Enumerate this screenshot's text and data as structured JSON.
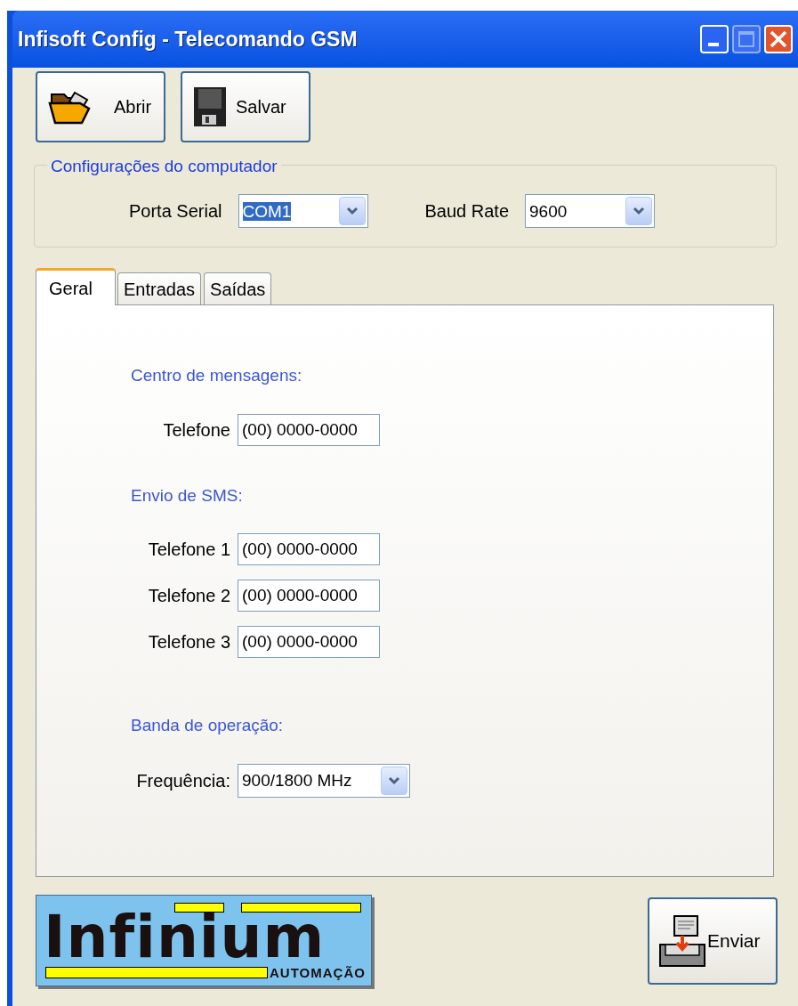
{
  "window": {
    "title": "Infisoft Config - Telecomando GSM"
  },
  "toolbar": [
    {
      "kind": "open",
      "label": "Abrir"
    },
    {
      "kind": "save",
      "label": "Salvar"
    }
  ],
  "computer_settings": {
    "title": "Configurações do computador",
    "fields": [
      {
        "label": "Porta Serial",
        "value": "COM1",
        "highlighted": true
      },
      {
        "label": "Baud Rate",
        "value": "9600",
        "highlighted": false
      }
    ]
  },
  "tabs": [
    {
      "label": "Geral",
      "selected": true
    },
    {
      "label": "Entradas",
      "selected": false
    },
    {
      "label": "Saídas",
      "selected": false
    }
  ],
  "sections": [
    {
      "heading": "Centro de mensagens:",
      "fields": [
        {
          "kind": "text",
          "label": "Telefone",
          "value": "(00) 0000-0000"
        }
      ]
    },
    {
      "heading": "Envio de SMS:",
      "fields": [
        {
          "kind": "text",
          "label": "Telefone 1",
          "value": "(00) 0000-0000"
        },
        {
          "kind": "text",
          "label": "Telefone 2",
          "value": "(00) 0000-0000"
        },
        {
          "kind": "text",
          "label": "Telefone 3",
          "value": "(00) 0000-0000"
        }
      ]
    },
    {
      "heading": "Banda de operação:",
      "fields": [
        {
          "kind": "combo",
          "label": "Frequência:",
          "value": "900/1800 MHz"
        }
      ]
    }
  ],
  "logo": {
    "name": "Infinium",
    "subtitle": "AUTOMAÇÃO"
  },
  "send_button": {
    "label": "Enviar"
  }
}
